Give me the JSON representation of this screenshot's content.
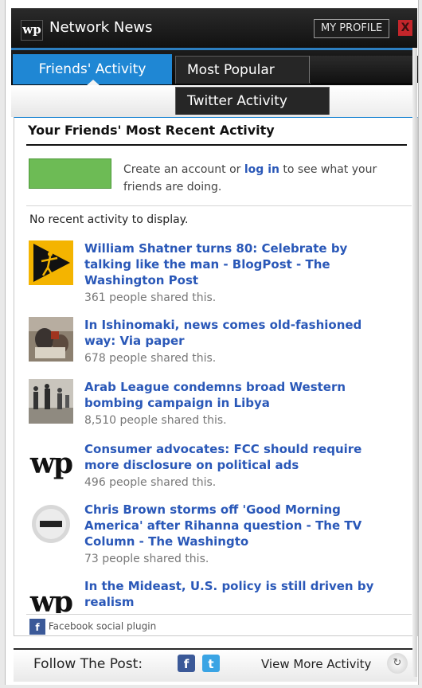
{
  "header": {
    "logo_text": "wp",
    "title": "Network News",
    "profile_button": "MY PROFILE",
    "close_label": "X"
  },
  "tabs": {
    "active": "Friends' Activity",
    "popular": "Most Popular",
    "twitter": "Twitter Activity"
  },
  "panel": {
    "title": "Your Friends' Most Recent Activity",
    "login_text_before": "Create an account or ",
    "login_link": "log in",
    "login_text_after": " to see what your friends are doing.",
    "no_activity": "No recent activity to display."
  },
  "items": [
    {
      "title": "William Shatner turns 80: Celebrate by talking like the man - BlogPost - The Washington Post",
      "count": "361 people shared this.",
      "thumb": "shatner-icon"
    },
    {
      "title": "In Ishinomaki, news comes old-fashioned way: Via paper",
      "count": "678 people shared this.",
      "thumb": "ishinomaki-photo"
    },
    {
      "title": "Arab League condemns broad Western bombing campaign in Libya",
      "count": "8,510 people shared this.",
      "thumb": "libya-photo"
    },
    {
      "title": "Consumer advocates: FCC should require more disclosure on political ads",
      "count": "496 people shared this.",
      "thumb": "wp-logo"
    },
    {
      "title": "Chris Brown storms off 'Good Morning America' after Rihanna question - The TV Column - The Washingto",
      "count": "73 people shared this.",
      "thumb": "column-icon"
    },
    {
      "title": "In the Mideast, U.S. policy is still driven by realism",
      "count": "",
      "thumb": "wp-logo"
    }
  ],
  "plugin": {
    "label": "Facebook social plugin",
    "icon_glyph": "f"
  },
  "footer": {
    "follow_label": "Follow The Post:",
    "fb_glyph": "f",
    "tw_glyph": "t",
    "view_more": "View More Activity"
  }
}
